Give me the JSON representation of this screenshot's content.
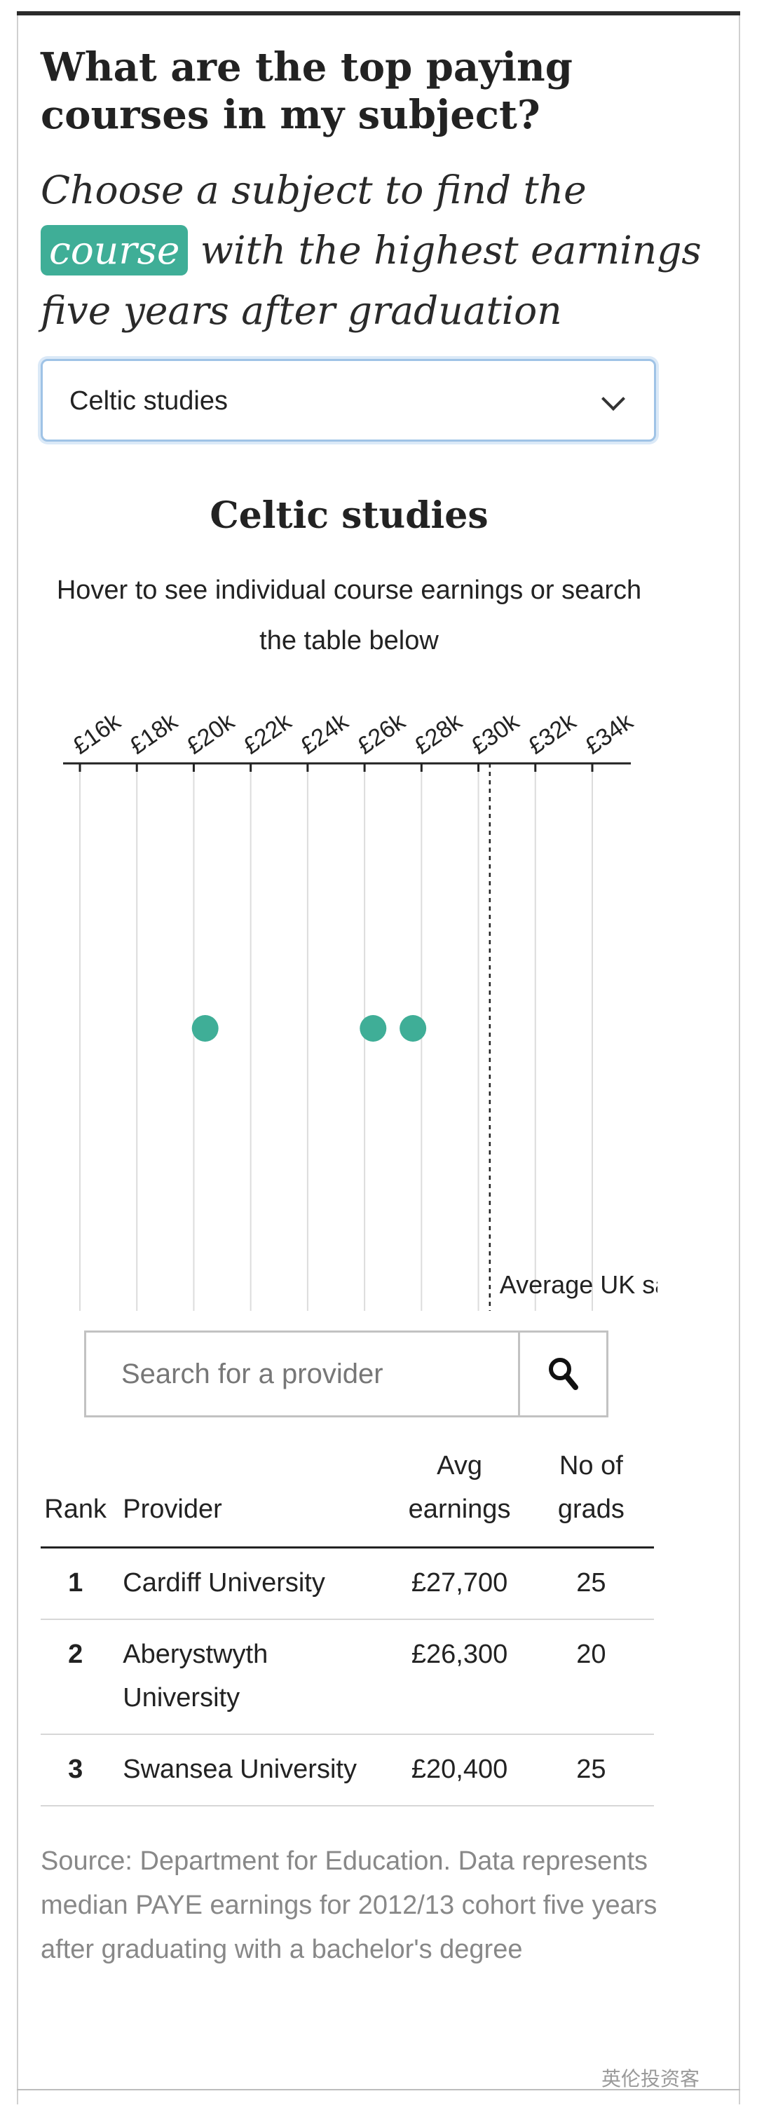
{
  "headline": "What are the top paying courses in my subject?",
  "standfirst": {
    "before": "Choose a subject to find the ",
    "highlight": "course",
    "after": " with the highest earnings five years after graduation"
  },
  "subject_select": {
    "value": "Celtic studies"
  },
  "chart_title": "Celtic studies",
  "chart_subtitle": "Hover to see individual course earnings or search the table below",
  "chart_data": {
    "type": "scatter",
    "x_ticks": [
      "£16k",
      "£18k",
      "£20k",
      "£22k",
      "£24k",
      "£26k",
      "£28k",
      "£30k",
      "£32k",
      "£34k"
    ],
    "xlim": [
      16000,
      34000
    ],
    "points": [
      {
        "provider": "Swansea University",
        "earnings": 20400
      },
      {
        "provider": "Aberystwyth University",
        "earnings": 26300
      },
      {
        "provider": "Cardiff University",
        "earnings": 27700
      }
    ],
    "reference_line": {
      "value": 30400,
      "label": "Average UK sa"
    },
    "grid": true,
    "point_color": "#3fae97"
  },
  "search": {
    "placeholder": "Search for a provider",
    "icon": "search-icon"
  },
  "table": {
    "headers": {
      "rank": "Rank",
      "provider": "Provider",
      "earnings": [
        "Avg",
        "earnings"
      ],
      "grads": [
        "No of",
        "grads"
      ]
    },
    "rows": [
      {
        "rank": "1",
        "provider": "Cardiff University",
        "earnings": "£27,700",
        "grads": "25"
      },
      {
        "rank": "2",
        "provider": "Aberystwyth University",
        "earnings": "£26,300",
        "grads": "20"
      },
      {
        "rank": "3",
        "provider": "Swansea University",
        "earnings": "£20,400",
        "grads": "25"
      }
    ]
  },
  "source": "Source: Department for Education. Data represents median PAYE earnings for 2012/13 cohort five years after graduating with a bachelor's degree",
  "watermark": "英伦投资客",
  "colors": {
    "accent": "#3fae97",
    "topbar": "#2b2b2b"
  }
}
